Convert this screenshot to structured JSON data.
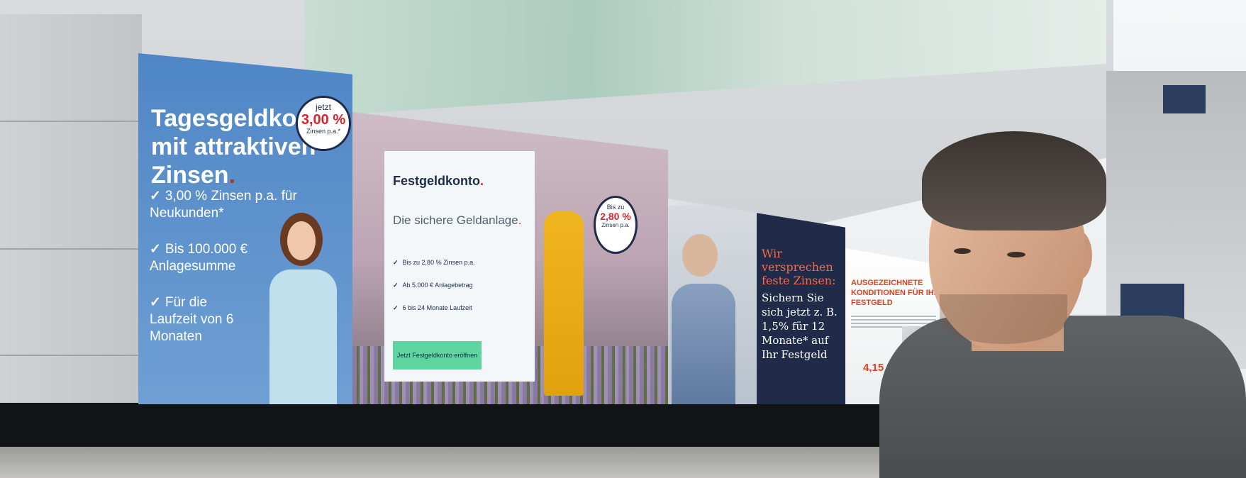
{
  "billboards": {
    "tagesgeld": {
      "title": "Tagesgeldkonto mit attraktiven Zinsen",
      "title_dot": ".",
      "badge": {
        "top": "jetzt",
        "rate": "3,00 %",
        "bottom": "Zinsen p.a.*"
      },
      "items": [
        "3,00 % Zinsen p.a. für Neukunden*",
        "Bis 100.000 € Anlagesumme",
        "Für die Laufzeit von 6 Monaten"
      ],
      "check_glyph": "✓"
    },
    "festgeld": {
      "title": "Festgeldkonto",
      "title_dot": ".",
      "subtitle": "Die sichere Geldanlage",
      "subtitle_dot": ".",
      "items": [
        "Bis zu 2,80 % Zinsen p.a.",
        "Ab 5.000 € Anlagebetrag",
        "6 bis 24 Monate Laufzeit"
      ],
      "cta": "Jetzt Festgeldkonto eröffnen",
      "badge": {
        "top": "Bis zu",
        "rate": "2,80 %",
        "bottom": "Zinsen p.a."
      }
    },
    "zinsen": {
      "headline": "Wir versprechen feste Zinsen:",
      "body": "Sichern Sie sich jetzt z. B. 1,5% für 12 Monate* auf Ihr Festgeld"
    },
    "konditionen": {
      "title": "AUSGEZEICHNETE KONDITIONEN FÜR IHR FESTGELD",
      "rate": "4,15 %"
    }
  },
  "colors": {
    "tagesgeld_blue": "#4f86c6",
    "navy": "#1f2b49",
    "brand_red": "#d9232d",
    "cta_green": "#5fd3a0",
    "coral": "#f26b4b",
    "orange_red": "#e0401f"
  }
}
